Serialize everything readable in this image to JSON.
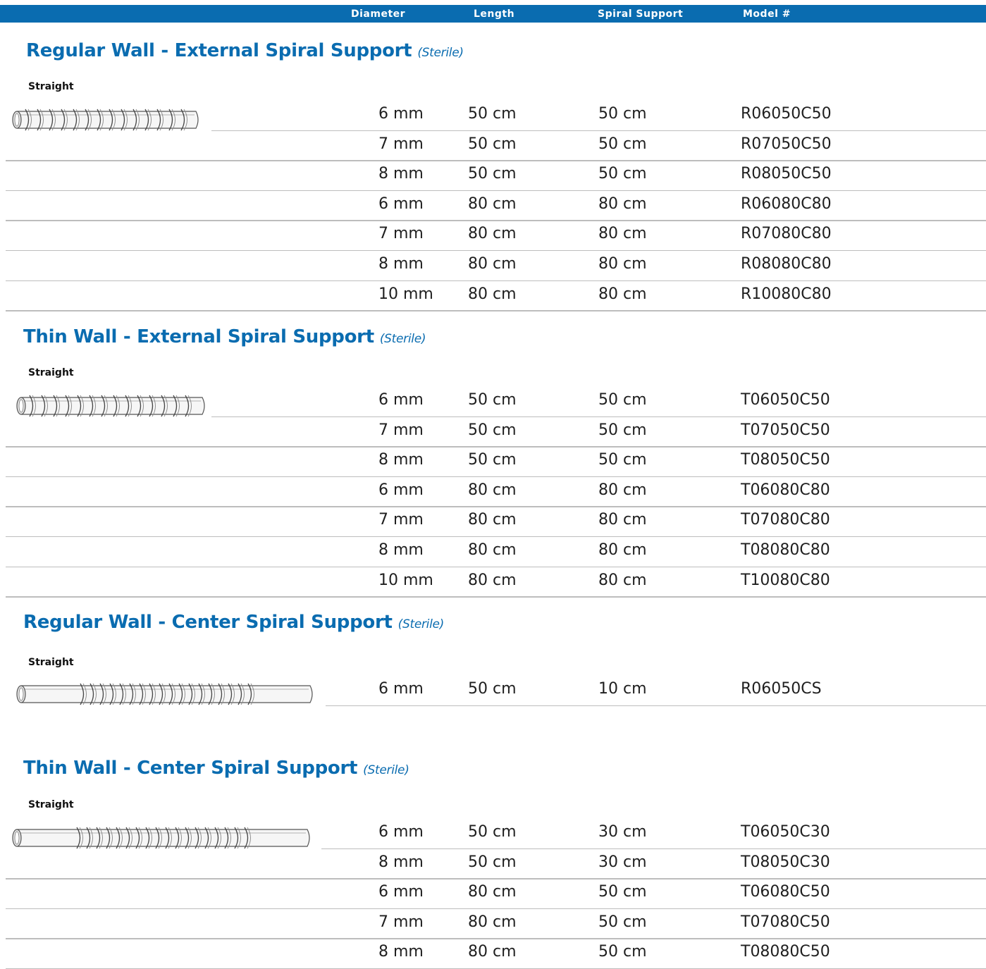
{
  "header": {
    "diameter": "Diameter",
    "length": "Length",
    "spiral_support": "Spiral Support",
    "model": "Model #"
  },
  "colors": {
    "brand_blue": "#0a6cb0",
    "rule_gray": "#bdbdbd"
  },
  "sections": [
    {
      "title": "Regular Wall - External Spiral Support",
      "sterile": "(Sterile)",
      "style": "Straight",
      "icon": "external-spiral-tube-icon",
      "rows": [
        [
          "6 mm",
          "50 cm",
          "50 cm",
          "R06050C50"
        ],
        [
          "7 mm",
          "50 cm",
          "50 cm",
          "R07050C50"
        ],
        [
          "8 mm",
          "50 cm",
          "50 cm",
          "R08050C50"
        ],
        [
          "6 mm",
          "80 cm",
          "80 cm",
          "R06080C80"
        ],
        [
          "7 mm",
          "80 cm",
          "80 cm",
          "R07080C80"
        ],
        [
          "8 mm",
          "80 cm",
          "80 cm",
          "R08080C80"
        ],
        [
          "10 mm",
          "80 cm",
          "80 cm",
          "R10080C80"
        ]
      ]
    },
    {
      "title": "Thin Wall - External Spiral Support",
      "sterile": "(Sterile)",
      "style": "Straight",
      "icon": "external-spiral-tube-icon",
      "rows": [
        [
          "6 mm",
          "50 cm",
          "50 cm",
          "T06050C50"
        ],
        [
          "7 mm",
          "50 cm",
          "50 cm",
          "T07050C50"
        ],
        [
          "8 mm",
          "50 cm",
          "50 cm",
          "T08050C50"
        ],
        [
          "6 mm",
          "80 cm",
          "80 cm",
          "T06080C80"
        ],
        [
          "7 mm",
          "80 cm",
          "80 cm",
          "T07080C80"
        ],
        [
          "8 mm",
          "80 cm",
          "80 cm",
          "T08080C80"
        ],
        [
          "10 mm",
          "80 cm",
          "80 cm",
          "T10080C80"
        ]
      ]
    },
    {
      "title": "Regular Wall - Center Spiral Support",
      "sterile": "(Sterile)",
      "style": "Straight",
      "icon": "center-spiral-tube-icon",
      "rows": [
        [
          "6 mm",
          "50 cm",
          "10 cm",
          "R06050CS"
        ]
      ]
    },
    {
      "title": "Thin Wall - Center Spiral Support",
      "sterile": "(Sterile)",
      "style": "Straight",
      "icon": "center-spiral-tube-icon",
      "rows": [
        [
          "6 mm",
          "50 cm",
          "30 cm",
          "T06050C30"
        ],
        [
          "8 mm",
          "50 cm",
          "30 cm",
          "T08050C30"
        ],
        [
          "6 mm",
          "80 cm",
          "50 cm",
          "T06080C50"
        ],
        [
          "7 mm",
          "80 cm",
          "50 cm",
          "T07080C50"
        ],
        [
          "8 mm",
          "80 cm",
          "50 cm",
          "T08080C50"
        ]
      ]
    }
  ]
}
